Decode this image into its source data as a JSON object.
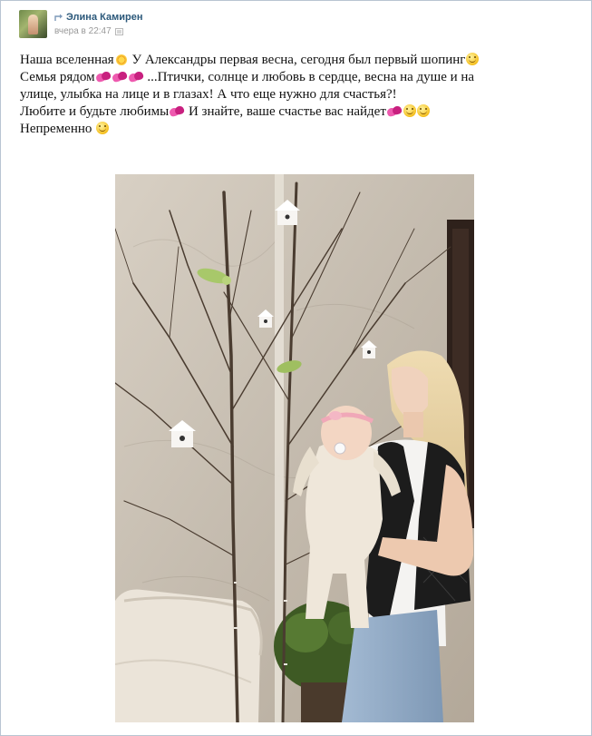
{
  "post": {
    "author": "Элина Камирен",
    "time": "вчера в 22:47",
    "text_lines": [
      "Наша вселенная",
      "У Александры первая весна, сегодня был первый шопинг",
      "Семья рядом",
      "...Птички, солнце и любовь в сердце, весна на душе и на",
      "улице, улыбка на лице и в глазах! А что еще нужно для счастья?!",
      "Любите и будьте любимы",
      "И знайте, ваше счастье вас найдет",
      "Непременно"
    ]
  },
  "icons": {
    "repost": "repost-arrow-icon",
    "photo": "photo-attachment-icon",
    "sun": "sun-emoji-icon",
    "smile": "smile-emoji-icon",
    "hearts": "two-hearts-emoji-icon",
    "wink": "wink-emoji-icon"
  },
  "photo": {
    "description_icon": "attached-photo",
    "colors": {
      "wall": "#c9c0b3",
      "sofa": "#e8e1d6",
      "vest": "#1c1c1c",
      "jeans": "#8fa9c4",
      "onesie": "#efe7da",
      "headband": "#f0a8b8",
      "hair": "#e9d5a8",
      "door": "#3a2a22",
      "birdhouse": "#f7f5f2",
      "bird": "#a8c86a"
    }
  },
  "colors": {
    "link": "#2b587a",
    "border": "#b9c4d2",
    "meta": "#999999",
    "text": "#111111"
  }
}
